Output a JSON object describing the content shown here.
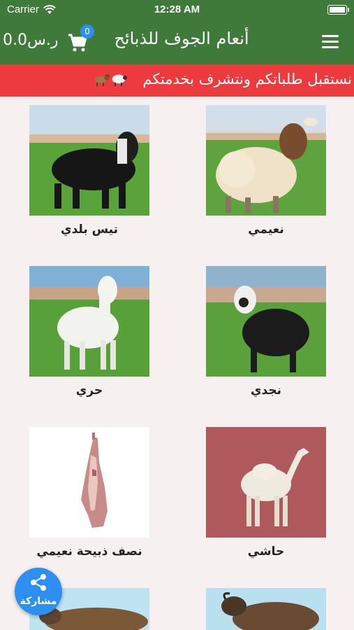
{
  "status_bar": {
    "carrier": "Carrier",
    "time": "12:28 AM"
  },
  "header": {
    "title": "أنعام الجوف للذبائح",
    "cart_count": "0",
    "cart_total": "0.0ر.س"
  },
  "ticker": {
    "text": "نستقبل طلباتكم ونتشرف بخدمتكم"
  },
  "products": [
    {
      "name": "نعيمي",
      "image": "sheep-naimi"
    },
    {
      "name": "تيس بلدي",
      "image": "goat-baladi"
    },
    {
      "name": "نجدي",
      "image": "sheep-najdi"
    },
    {
      "name": "حري",
      "image": "sheep-harri"
    },
    {
      "name": "حاشي",
      "image": "camel-hashi"
    },
    {
      "name": "نصف ذبيحة نعيمي",
      "image": "half-carcass"
    },
    {
      "name": "",
      "image": "sheep-brown"
    },
    {
      "name": "",
      "image": "sheep-lying"
    }
  ],
  "share": {
    "label": "مشاركة"
  },
  "colors": {
    "header": "#3f7a3a",
    "ticker": "#ec3a3e",
    "accent": "#2d8ff0"
  }
}
